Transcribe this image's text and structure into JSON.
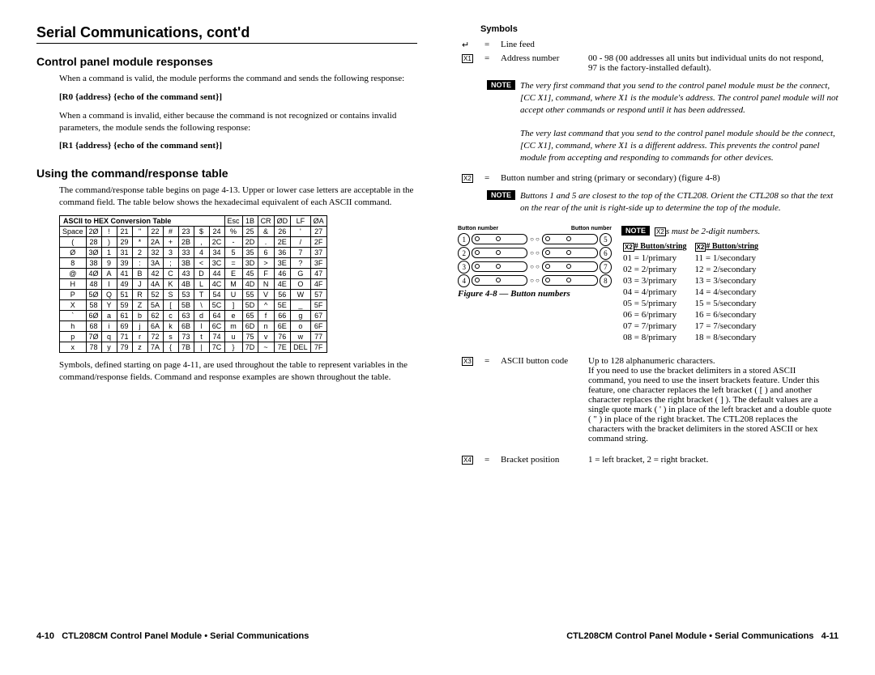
{
  "leftPage": {
    "mainHeading": "Serial Communications, cont'd",
    "h2a": "Control panel module responses",
    "p1": "When a command is valid, the module performs the command and sends the following response:",
    "code1": "[R0 {address} {echo of the command sent}]",
    "p2": "When a command is invalid, either because the command is not recognized or contains invalid parameters, the module sends the following response:",
    "code2": "[R1 {address} {echo of the command sent}]",
    "h2b": "Using the command/response table",
    "p3": "The command/response table begins on page 4-13.  Upper or lower case letters are acceptable in the command field.  The table below shows the hexadecimal equivalent of each ASCII command.",
    "asciiTitle": "ASCII to HEX  Conversion Table",
    "asciiHeader": [
      "Esc",
      "1B",
      "CR",
      "ØD",
      "LF",
      "ØA"
    ],
    "asciiRows": [
      [
        "Space",
        "2Ø",
        "!",
        "21",
        "\"",
        "22",
        "#",
        "23",
        "$",
        "24",
        "%",
        "25",
        "&",
        "26",
        "'",
        "27"
      ],
      [
        "(",
        "28",
        ")",
        "29",
        "*",
        "2A",
        "+",
        "2B",
        ",",
        "2C",
        "-",
        "2D",
        ".",
        "2E",
        "/",
        "2F"
      ],
      [
        "Ø",
        "3Ø",
        "1",
        "31",
        "2",
        "32",
        "3",
        "33",
        "4",
        "34",
        "5",
        "35",
        "6",
        "36",
        "7",
        "37"
      ],
      [
        "8",
        "38",
        "9",
        "39",
        ":",
        "3A",
        ";",
        "3B",
        "<",
        "3C",
        "=",
        "3D",
        ">",
        "3E",
        "?",
        "3F"
      ],
      [
        "@",
        "4Ø",
        "A",
        "41",
        "B",
        "42",
        "C",
        "43",
        "D",
        "44",
        "E",
        "45",
        "F",
        "46",
        "G",
        "47"
      ],
      [
        "H",
        "48",
        "I",
        "49",
        "J",
        "4A",
        "K",
        "4B",
        "L",
        "4C",
        "M",
        "4D",
        "N",
        "4E",
        "O",
        "4F"
      ],
      [
        "P",
        "5Ø",
        "Q",
        "51",
        "R",
        "52",
        "S",
        "53",
        "T",
        "54",
        "U",
        "55",
        "V",
        "56",
        "W",
        "57"
      ],
      [
        "X",
        "58",
        "Y",
        "59",
        "Z",
        "5A",
        "[",
        "5B",
        "\\",
        "5C",
        "]",
        "5D",
        "^",
        "5E",
        "_",
        "5F"
      ],
      [
        "`",
        "6Ø",
        "a",
        "61",
        "b",
        "62",
        "c",
        "63",
        "d",
        "64",
        "e",
        "65",
        "f",
        "66",
        "g",
        "67"
      ],
      [
        "h",
        "68",
        "i",
        "69",
        "j",
        "6A",
        "k",
        "6B",
        "l",
        "6C",
        "m",
        "6D",
        "n",
        "6E",
        "o",
        "6F"
      ],
      [
        "p",
        "7Ø",
        "q",
        "71",
        "r",
        "72",
        "s",
        "73",
        "t",
        "74",
        "u",
        "75",
        "v",
        "76",
        "w",
        "77"
      ],
      [
        "x",
        "78",
        "y",
        "79",
        "z",
        "7A",
        "{",
        "7B",
        "|",
        "7C",
        "}",
        "7D",
        "~",
        "7E",
        "DEL",
        "7F"
      ]
    ],
    "p4": "Symbols, defined starting on page 4-11, are used throughout the table to represent variables in the command/response fields.  Command and response examples are shown throughout the table.",
    "footer": "CTL208CM Control Panel Module • Serial Communications",
    "pageNum": "4-10"
  },
  "rightPage": {
    "h3": "Symbols",
    "sym1": {
      "sym": "↵",
      "eq": "=",
      "label": "Line feed"
    },
    "sym2": {
      "sym": "X1",
      "eq": "=",
      "label": "Address number",
      "desc": "00 - 98 (00 addresses all units but individual units do not respond, 97 is the factory-installed default)."
    },
    "note1": "The very first command that you send to the control panel module must be the connect, [CC X1], command, where X1 is the module's address.  The control panel module will not accept other commands or respond until it has been addressed.",
    "note1b": "The very last command that you send to the control panel module should be the connect, [CC X1], command, where X1 is a different address.  This prevents the control panel module from accepting and responding to commands for other devices.",
    "sym3": {
      "sym": "X2",
      "eq": "=",
      "label": "Button number and string (primary or secondary) (figure 4-8)"
    },
    "note2": "Buttons 1 and 5 are closest to the top of the CTL208.  Orient the CTL208 so that the text on the rear of the unit is right-side up to determine the top of the module.",
    "note3pre": "X2",
    "note3": "s must be 2-digit numbers.",
    "btnNumLabel": "Button number",
    "bsHead1": "X2# Button/string",
    "bsHead2": "X2# Button/string",
    "bsRows": [
      [
        "01 = 1/primary",
        "11 = 1/secondary"
      ],
      [
        "02 = 2/primary",
        "12 = 2/secondary"
      ],
      [
        "03 = 3/primary",
        "13 = 3/secondary"
      ],
      [
        "04 = 4/primary",
        "14 = 4/secondary"
      ],
      [
        "05 = 5/primary",
        "15 = 5/secondary"
      ],
      [
        "06 = 6/primary",
        "16 = 6/secondary"
      ],
      [
        "07 = 7/primary",
        "17 = 7/secondary"
      ],
      [
        "08 = 8/primary",
        "18 = 8/secondary"
      ]
    ],
    "figCap": "Figure 4-8 — Button numbers",
    "sym4": {
      "sym": "X3",
      "eq": "=",
      "label": "ASCII button code",
      "desc": "Up to 128 alphanumeric characters.\nIf you need to use the bracket delimiters in a stored ASCII command, you need to use the insert brackets feature.  Under this feature, one character replaces the left bracket ( [ ) and another character replaces the right bracket ( ] ).  The default values are a single quote mark ( ' ) in place of the left bracket and a double quote ( \" ) in place of the right bracket. The CTL208 replaces the characters with the bracket delimiters in the stored ASCII or hex command string."
    },
    "sym5": {
      "sym": "X4",
      "eq": "=",
      "label": "Bracket position",
      "desc": "1 = left bracket, 2 = right bracket."
    },
    "footer": "CTL208CM Control Panel Module • Serial Communications",
    "pageNum": "4-11",
    "noteLabel": "NOTE"
  }
}
